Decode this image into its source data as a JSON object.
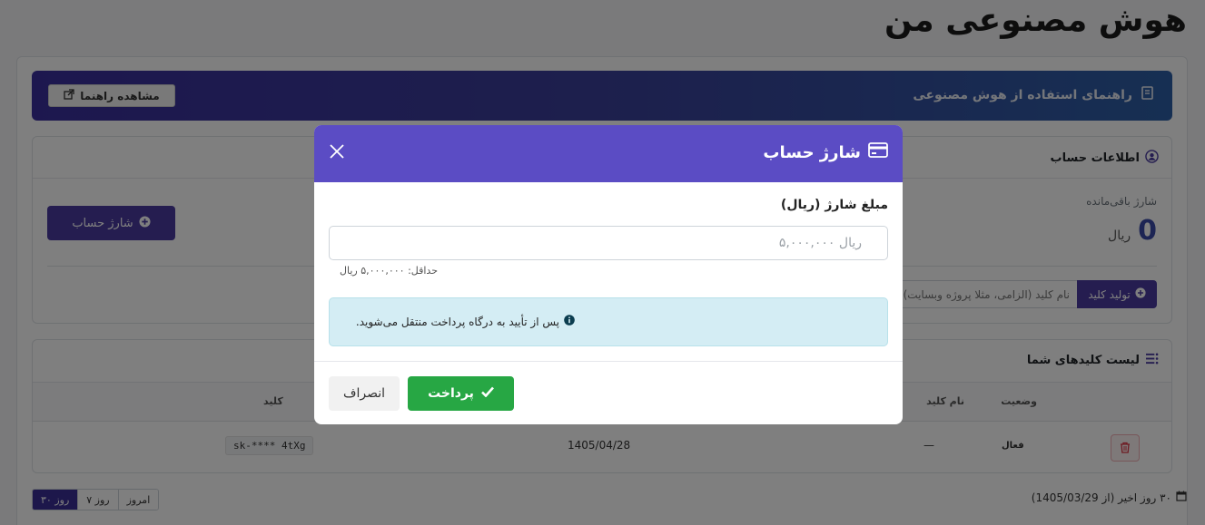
{
  "page": {
    "title": "هوش مصنوعی من"
  },
  "guide": {
    "title": "راهنمای استفاده از هوش مصنوعی",
    "button_label": "مشاهده راهنما"
  },
  "account": {
    "title": "اطلاعات حساب",
    "balance_label": "شارژ باقی‌مانده",
    "balance_value": "0",
    "balance_unit": "ریال",
    "charge_button": "شارژ حساب",
    "generate_button": "تولید کلید",
    "key_name_placeholder": "نام کلید (الزامی، مثلا پروژه وبسایت)"
  },
  "keys": {
    "title": "لیست کلیدهای شما",
    "columns": {
      "status": "وضعیت",
      "name": "نام کلید",
      "key": "کلید"
    },
    "rows": [
      {
        "status": "فعال",
        "name": "—",
        "date": "1405/04/28",
        "key": "sk-**** 4tXg"
      }
    ]
  },
  "footer": {
    "range_buttons": [
      "امروز",
      "۷ روز",
      "۳۰ روز"
    ],
    "active_range": "۳۰ روز",
    "info": "۳۰ روز اخیر (از 1405/03/29)"
  },
  "modal": {
    "title": "شارژ حساب",
    "amount_label": "مبلغ شارژ (ریال)",
    "amount_placeholder": "ریال ۵,۰۰۰,۰۰۰",
    "min_hint": "حداقل: ۵,۰۰۰,۰۰۰ ریال",
    "info": "پس از تأیید به درگاه پرداخت منتقل می‌شوید.",
    "pay_button": "پرداخت",
    "cancel_button": "انصراف"
  },
  "colors": {
    "primary": "#4a3aa0",
    "modal_header": "#5b4cc4",
    "success": "#27a744",
    "info_bg": "#d4edf4"
  }
}
